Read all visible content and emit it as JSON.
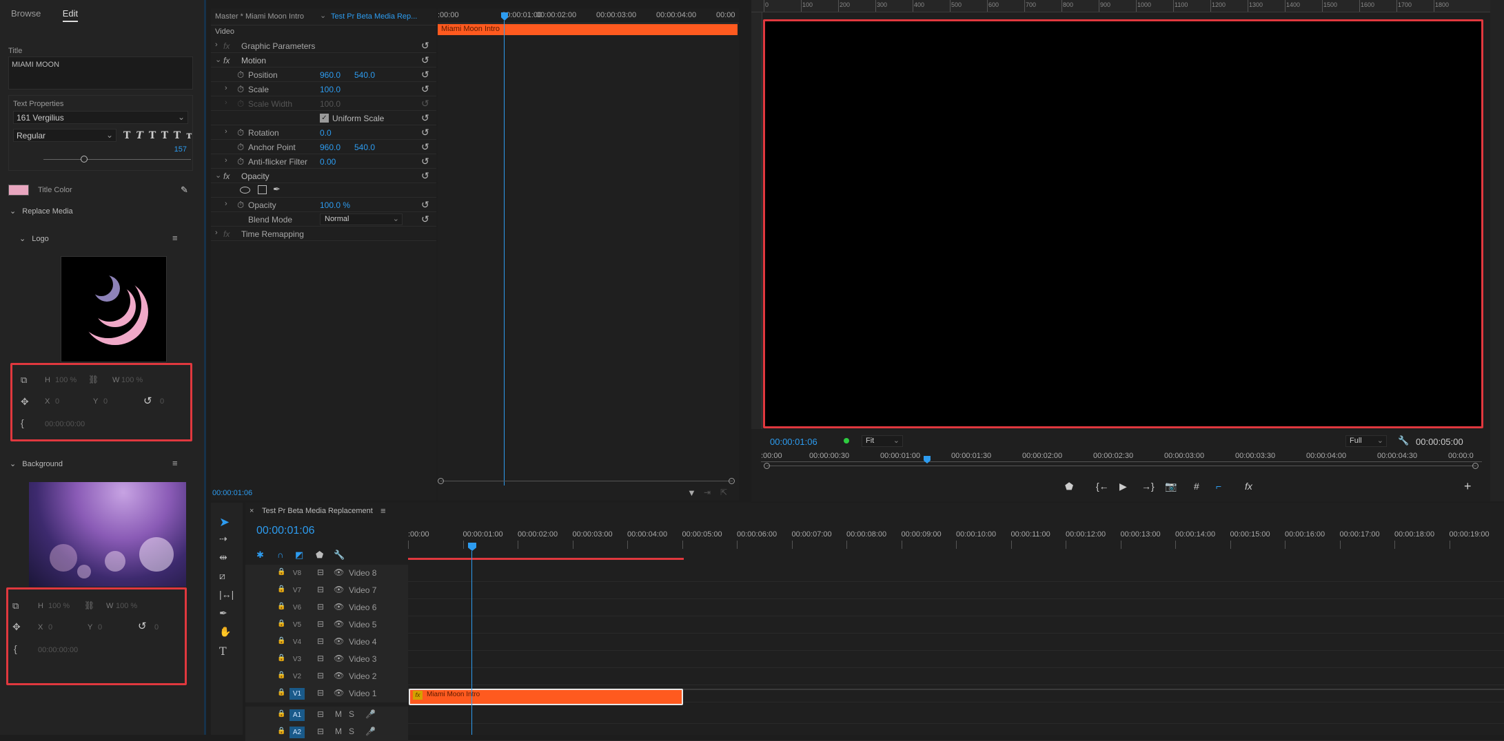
{
  "left_panel": {
    "tabs": [
      "Browse",
      "Edit"
    ],
    "active_tab": "Edit",
    "title_label": "Title",
    "title_value": "MIAMI MOON",
    "text_properties_label": "Text Properties",
    "font": "161 Vergilius",
    "font_style": "Regular",
    "font_size": "157",
    "title_color_label": "Title Color",
    "title_color": "#e8a6bf",
    "replace_media_label": "Replace Media",
    "logo_label": "Logo",
    "background_label": "Background",
    "logo_controls": {
      "h_label": "H",
      "h_value": "100 %",
      "w_label": "W",
      "w_value": "100 %",
      "x_label": "X",
      "x_value": "0",
      "y_label": "Y",
      "y_value": "0",
      "rot_value": "0",
      "time_value": "00:00:00:00"
    },
    "bg_controls": {
      "h_label": "H",
      "h_value": "100 %",
      "w_label": "W",
      "w_value": "100 %",
      "x_label": "X",
      "x_value": "0",
      "y_label": "Y",
      "y_value": "0",
      "rot_value": "0",
      "time_value": "00:00:00:00"
    }
  },
  "effect_controls": {
    "source_tab": "Master * Miami Moon Intro",
    "sequence_tab": "Test Pr Beta Media Rep...",
    "section_video": "Video",
    "rows": {
      "graphic_parameters": "Graphic Parameters",
      "motion": "Motion",
      "position": "Position",
      "position_x": "960.0",
      "position_y": "540.0",
      "scale": "Scale",
      "scale_v": "100.0",
      "scale_width": "Scale Width",
      "scale_width_v": "100.0",
      "uniform_scale": "Uniform Scale",
      "rotation": "Rotation",
      "rotation_v": "0.0",
      "anchor_point": "Anchor Point",
      "anchor_x": "960.0",
      "anchor_y": "540.0",
      "anti_flicker": "Anti-flicker Filter",
      "anti_flicker_v": "0.00",
      "opacity_section": "Opacity",
      "opacity": "Opacity",
      "opacity_v": "100.0 %",
      "blend_mode": "Blend Mode",
      "blend_mode_v": "Normal",
      "time_remapping": "Time Remapping"
    },
    "current_time": "00:00:01:06",
    "timeline": {
      "ticks": [
        ":00:00",
        "00:00:01:00",
        "00:00:02:00",
        "00:00:03:00",
        "00:00:04:00",
        "00:00"
      ],
      "clip_label": "Miami Moon Intro"
    }
  },
  "program_monitor": {
    "ruler_labels": [
      "0",
      "100",
      "200",
      "300",
      "400",
      "500",
      "600",
      "700",
      "800",
      "900",
      "1000",
      "1100",
      "1200",
      "1300",
      "1400",
      "1500",
      "1600",
      "1700",
      "1800"
    ],
    "current_time": "00:00:01:06",
    "fit": "Fit",
    "quality": "Full",
    "duration": "00:00:05:00",
    "ticks": [
      ":00:00",
      "00:00:00:30",
      "00:00:01:00",
      "00:00:01:30",
      "00:00:02:00",
      "00:00:02:30",
      "00:00:03:00",
      "00:00:03:30",
      "00:00:04:00",
      "00:00:04:30",
      "00:00:0"
    ]
  },
  "timeline": {
    "sequence_name": "Test Pr Beta Media Replacement",
    "current_time": "00:00:01:06",
    "ticks": [
      ":00:00",
      "00:00:01:00",
      "00:00:02:00",
      "00:00:03:00",
      "00:00:04:00",
      "00:00:05:00",
      "00:00:06:00",
      "00:00:07:00",
      "00:00:08:00",
      "00:00:09:00",
      "00:00:10:00",
      "00:00:11:00",
      "00:00:12:00",
      "00:00:13:00",
      "00:00:14:00",
      "00:00:15:00",
      "00:00:16:00",
      "00:00:17:00",
      "00:00:18:00",
      "00:00:19:00",
      "00:00"
    ],
    "video_tracks": [
      {
        "tag": "V8",
        "name": "Video 8"
      },
      {
        "tag": "V7",
        "name": "Video 7"
      },
      {
        "tag": "V6",
        "name": "Video 6"
      },
      {
        "tag": "V5",
        "name": "Video 5"
      },
      {
        "tag": "V4",
        "name": "Video 4"
      },
      {
        "tag": "V3",
        "name": "Video 3"
      },
      {
        "tag": "V2",
        "name": "Video 2"
      },
      {
        "tag": "V1",
        "name": "Video 1",
        "target": true
      }
    ],
    "audio_tracks": [
      {
        "tag": "A1",
        "m": "M",
        "s": "S"
      },
      {
        "tag": "A2",
        "m": "M",
        "s": "S"
      }
    ],
    "clip_label": "Miami Moon Intro",
    "clip_badge": "fx",
    "clip_color": "#ff5a1f"
  }
}
